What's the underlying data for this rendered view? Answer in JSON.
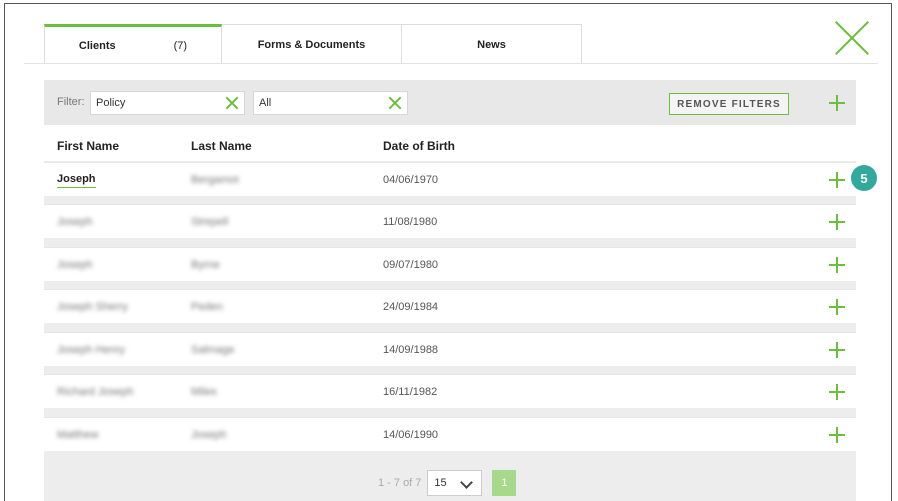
{
  "tabs": [
    {
      "label": "Clients",
      "count": "(7)"
    },
    {
      "label": "Forms & Documents"
    },
    {
      "label": "News"
    }
  ],
  "filter": {
    "label": "Filter:",
    "field1_value": "Policy",
    "field2_value": "All",
    "remove_filters_label": "REMOVE FILTERS"
  },
  "table": {
    "headers": [
      "First Name",
      "Last Name",
      "Date of Birth"
    ],
    "rows": [
      {
        "first_name": "Joseph",
        "last_name": "Bergamot",
        "dob": "04/06/1970"
      },
      {
        "first_name": "Joseph",
        "last_name": "Strepell",
        "dob": "11/08/1980"
      },
      {
        "first_name": "Joseph",
        "last_name": "Byrne",
        "dob": "09/07/1980"
      },
      {
        "first_name": "Joseph Sherry",
        "last_name": "Peden",
        "dob": "24/09/1984"
      },
      {
        "first_name": "Joseph Henry",
        "last_name": "Salmage",
        "dob": "14/09/1988"
      },
      {
        "first_name": "Richard Joseph",
        "last_name": "Miles",
        "dob": "16/11/1982"
      },
      {
        "first_name": "Matthew",
        "last_name": "Joseph",
        "dob": "14/06/1990"
      }
    ]
  },
  "badge": "5",
  "pager": {
    "info": "1 - 7 of 7",
    "page_size": "15",
    "current_page": "1"
  },
  "colors": {
    "accent": "#6cbf3a",
    "badge": "#33a99e",
    "filter_bar": "#e8e8e8"
  },
  "icons": [
    "close-icon",
    "clear-icon",
    "plus-icon",
    "chevron-down-icon"
  ]
}
